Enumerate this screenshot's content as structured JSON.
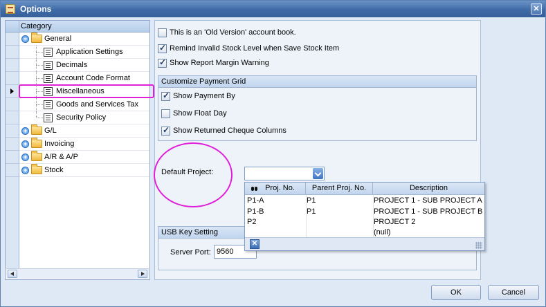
{
  "window": {
    "title": "Options",
    "close_label": "✕"
  },
  "tree": {
    "header": "Category",
    "items": [
      {
        "label": "General",
        "expander": "−"
      },
      {
        "label": "Application Settings"
      },
      {
        "label": "Decimals"
      },
      {
        "label": "Account Code Format"
      },
      {
        "label": "Miscellaneous"
      },
      {
        "label": "Goods and Services Tax"
      },
      {
        "label": "Security Policy"
      },
      {
        "label": "G/L",
        "expander": "+"
      },
      {
        "label": "Invoicing",
        "expander": "+"
      },
      {
        "label": "A/R & A/P",
        "expander": "+"
      },
      {
        "label": "Stock",
        "expander": "+"
      }
    ],
    "selected": "Miscellaneous"
  },
  "settings": {
    "old_version": {
      "label": "This is an 'Old Version' account book.",
      "checked": false
    },
    "remind_invalid_stock": {
      "label": "Remind Invalid Stock Level when Save Stock Item",
      "checked": true
    },
    "show_margin_warning": {
      "label": "Show Report Margin Warning",
      "checked": true
    }
  },
  "payment_grid": {
    "title": "Customize Payment Grid",
    "show_payment_by": {
      "label": "Show Payment By",
      "checked": true
    },
    "show_float_day": {
      "label": "Show Float Day",
      "checked": false
    },
    "show_returned_cheque": {
      "label": "Show Returned Cheque Columns",
      "checked": true
    }
  },
  "default_project": {
    "label": "Default Project:",
    "value": "",
    "columns": [
      "Proj. No.",
      "Parent Proj. No.",
      "Description"
    ],
    "rows": [
      [
        "P1-A",
        "P1",
        "PROJECT 1 - SUB PROJECT A"
      ],
      [
        "P1-B",
        "P1",
        "PROJECT 1 - SUB PROJECT B"
      ],
      [
        "P2",
        "",
        "PROJECT 2"
      ],
      [
        "",
        "",
        "(null)"
      ]
    ]
  },
  "usb": {
    "title": "USB Key Setting",
    "server_port_label": "Server Port:",
    "server_port": "9560"
  },
  "buttons": {
    "ok": "OK",
    "cancel": "Cancel"
  },
  "colors": {
    "annotation": "#e020d8",
    "titlebar": "#3e6aa6"
  }
}
